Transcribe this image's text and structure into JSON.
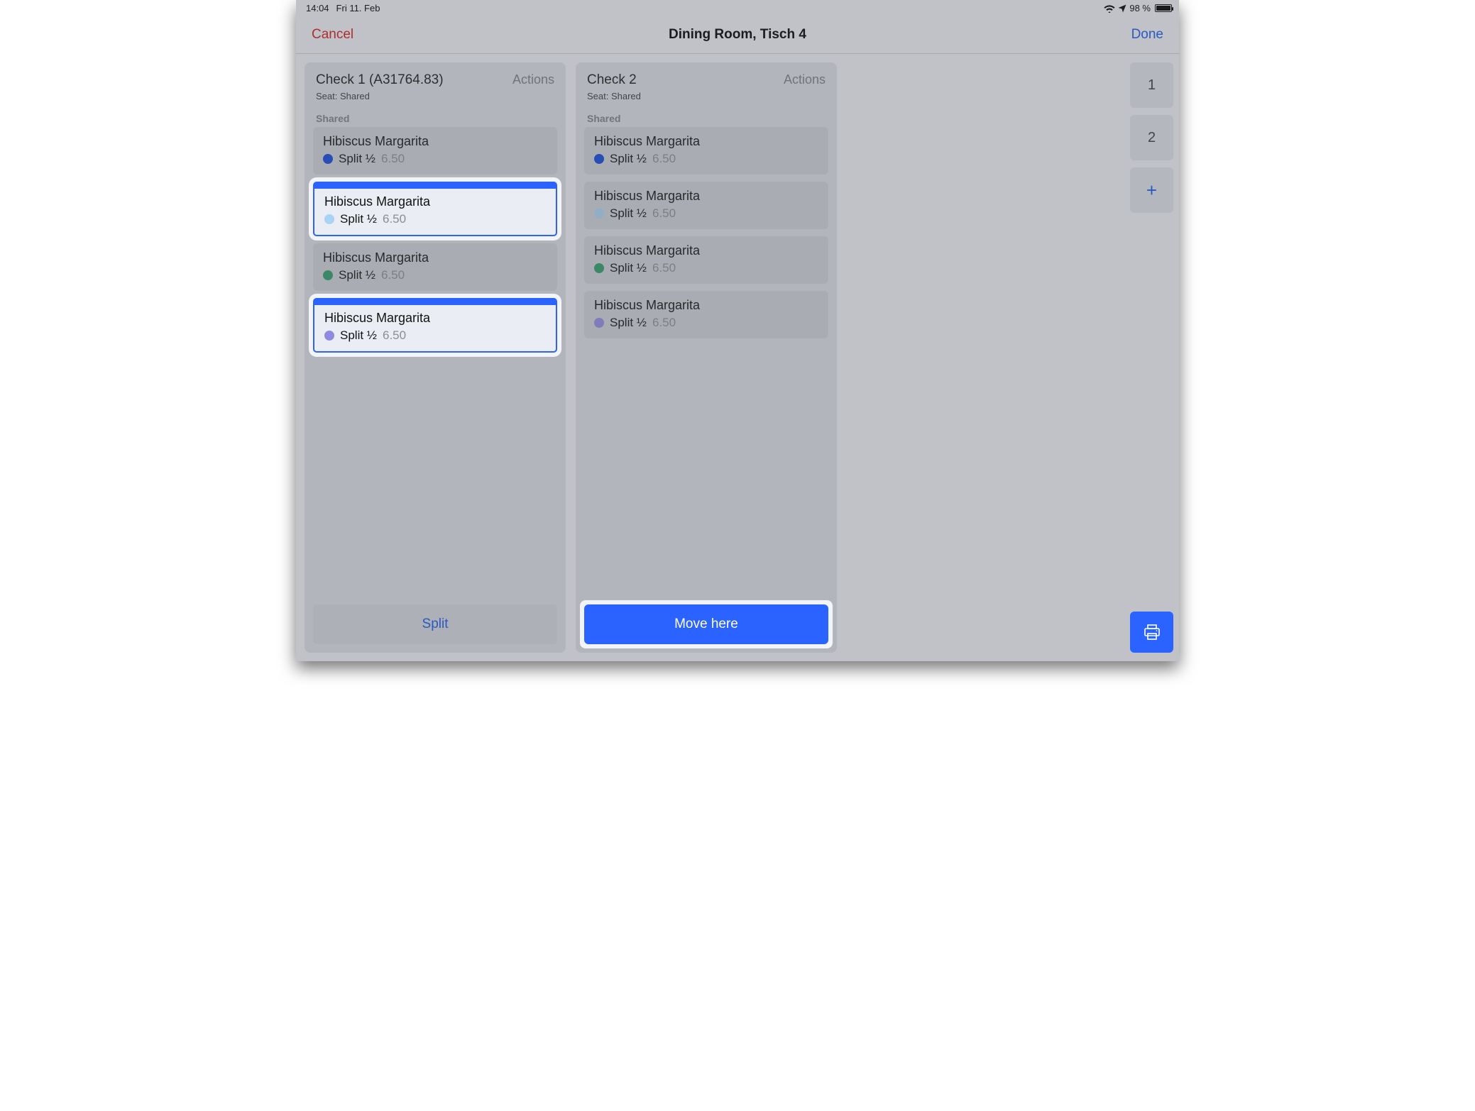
{
  "status": {
    "time": "14:04",
    "date": "Fri 11. Feb",
    "battery": "98 %"
  },
  "nav": {
    "cancel": "Cancel",
    "title": "Dining Room, Tisch 4",
    "done": "Done"
  },
  "checks": [
    {
      "title": "Check 1  (A31764.83)",
      "seat": "Seat: Shared",
      "actions": "Actions",
      "section": "Shared",
      "footer": "Split",
      "footerStyle": "ghost",
      "items": [
        {
          "name": "Hibiscus Margarita",
          "split": "Split ½",
          "price": "6.50",
          "color": "#1447d8",
          "selected": false
        },
        {
          "name": "Hibiscus Margarita",
          "split": "Split ½",
          "price": "6.50",
          "color": "#a8d3f2",
          "selected": true
        },
        {
          "name": "Hibiscus Margarita",
          "split": "Split ½",
          "price": "6.50",
          "color": "#2e9a68",
          "selected": false
        },
        {
          "name": "Hibiscus Margarita",
          "split": "Split ½",
          "price": "6.50",
          "color": "#8e8ae0",
          "selected": true
        }
      ]
    },
    {
      "title": "Check 2",
      "seat": "Seat: Shared",
      "actions": "Actions",
      "section": "Shared",
      "footer": "Move here",
      "footerStyle": "primary",
      "items": [
        {
          "name": "Hibiscus Margarita",
          "split": "Split ½",
          "price": "6.50",
          "color": "#1447d8",
          "selected": false
        },
        {
          "name": "Hibiscus Margarita",
          "split": "Split ½",
          "price": "6.50",
          "color": "#a8d3f2",
          "selected": false
        },
        {
          "name": "Hibiscus Margarita",
          "split": "Split ½",
          "price": "6.50",
          "color": "#2e9a68",
          "selected": false
        },
        {
          "name": "Hibiscus Margarita",
          "split": "Split ½",
          "price": "6.50",
          "color": "#8e8ae0",
          "selected": false
        }
      ]
    }
  ],
  "sidebar": {
    "buttons": [
      "1",
      "2"
    ],
    "plus": "+"
  }
}
